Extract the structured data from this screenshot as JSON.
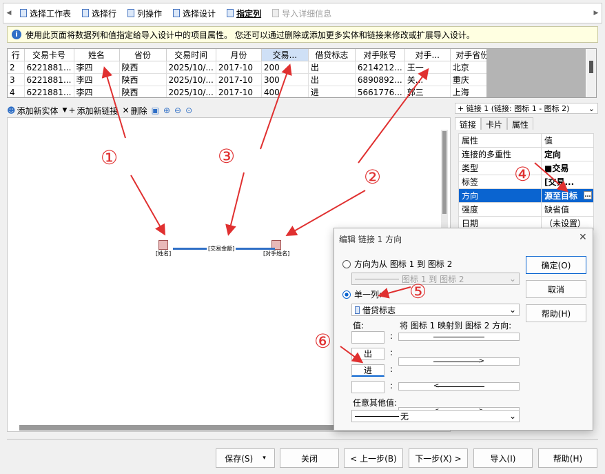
{
  "wizard_tabs": [
    {
      "label": "选择工作表",
      "active": false,
      "disabled": false
    },
    {
      "label": "选择行",
      "active": false,
      "disabled": false
    },
    {
      "label": "列操作",
      "active": false,
      "disabled": false
    },
    {
      "label": "选择设计",
      "active": false,
      "disabled": false
    },
    {
      "label": "指定列",
      "active": true,
      "disabled": false
    },
    {
      "label": "导入详细信息",
      "active": false,
      "disabled": true
    }
  ],
  "info_text": "使用此页面将数据列和值指定给导入设计中的项目属性。 您还可以通过删除或添加更多实体和链接来修改或扩展导入设计。",
  "grid": {
    "columns": [
      "行",
      "交易卡号",
      "姓名",
      "省份",
      "交易时间",
      "月份",
      "交易...",
      "借贷标志",
      "对手账号",
      "对手...",
      "对手省份"
    ],
    "rows": [
      [
        "2",
        "6221881...",
        "李四",
        "陕西",
        "2025/10/...",
        "2017-10",
        "200",
        "出",
        "6214212...",
        "王一",
        "北京"
      ],
      [
        "3",
        "6221881...",
        "李四",
        "陕西",
        "2025/10/...",
        "2017-10",
        "300",
        "出",
        "6890892...",
        "关...",
        "重庆"
      ],
      [
        "4",
        "6221881...",
        "李四",
        "陕西",
        "2025/10/...",
        "2017-10",
        "400",
        "进",
        "5661776...",
        "郭三",
        "上海"
      ]
    ]
  },
  "design_toolbar": {
    "add_entity": "添加新实体",
    "add_link": "添加新链接",
    "delete": "删除"
  },
  "diagram": {
    "node_left": "[姓名]",
    "node_right": "[对手姓名]",
    "link_label": "[交易金额]"
  },
  "right_panel": {
    "link_selector": "链接 1 (链接: 图标 1 - 图标 2)",
    "tabs": [
      "链接",
      "卡片",
      "属性"
    ],
    "header": [
      "属性",
      "值"
    ],
    "properties": [
      {
        "name": "连接的多重性",
        "value": "定向"
      },
      {
        "name": "类型",
        "value": "交易"
      },
      {
        "name": "标签",
        "value": "[交易..."
      },
      {
        "name": "方向",
        "value": "源至目标"
      },
      {
        "name": "强度",
        "value": "缺省值"
      },
      {
        "name": "日期",
        "value": "（未设置）"
      }
    ]
  },
  "annotations": [
    "①",
    "②",
    "③",
    "④",
    "⑤",
    "⑥"
  ],
  "dialog": {
    "title": "编辑 链接 1 方向",
    "option_from": "方向为从 图标 1 到 图标 2",
    "option_from_combo": "图标 1 到 图标 2",
    "option_column": "单一列:",
    "column_combo": "借贷标志",
    "value_label": "值:",
    "mapping_label": "将 图标 1 映射到 图标 2 方向:",
    "values": [
      "",
      "出",
      "进",
      ""
    ],
    "any_other_label": "任意其他值:",
    "any_other_combo": "无",
    "ok": "确定(O)",
    "cancel": "取消",
    "help": "帮助(H)"
  },
  "bottom_buttons": {
    "save": "保存(S)",
    "close": "关闭",
    "prev": "< 上一步(B)",
    "next": "下一步(X) >",
    "import": "导入(I)",
    "help": "帮助(H)"
  },
  "colors": {
    "annotation": "#e03030",
    "selection": "#0a64d0",
    "info_bg": "#ffffe1"
  }
}
